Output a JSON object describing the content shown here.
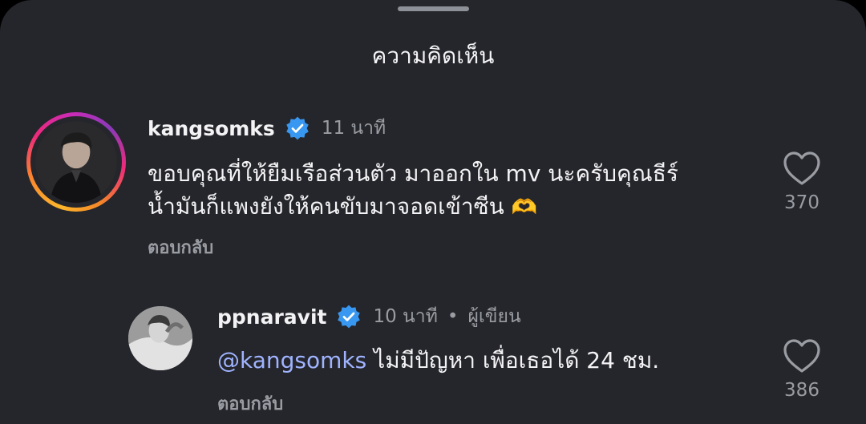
{
  "sheet": {
    "title": "ความคิดเห็น"
  },
  "comments": [
    {
      "username": "kangsomks",
      "time": "11 นาที",
      "line1": "ขอบคุณที่ให้ยืมเรือส่วนตัว มาออกใน mv นะครับคุณธีร์",
      "line2": "น้ำมันก็แพงยังให้คนขับมาจอดเข้าซีน",
      "emoji": "🫶",
      "reply_label": "ตอบกลับ",
      "likes": "370",
      "avatar_icon": "story-ring-avatar"
    },
    {
      "username": "ppnaravit",
      "time": "10 นาที",
      "separator": "•",
      "author_tag": "ผู้เขียน",
      "mention": "@kangsomks",
      "text": "ไม่มีปัญหา เพื่อเธอได้ 24 ชม.",
      "reply_label": "ตอบกลับ",
      "likes": "386",
      "avatar_icon": "avatar"
    }
  ],
  "colors": {
    "background": "#25262b",
    "verified": "#3897f0",
    "mention": "#9fb3ff",
    "secondary_text": "#9a9ca3"
  }
}
